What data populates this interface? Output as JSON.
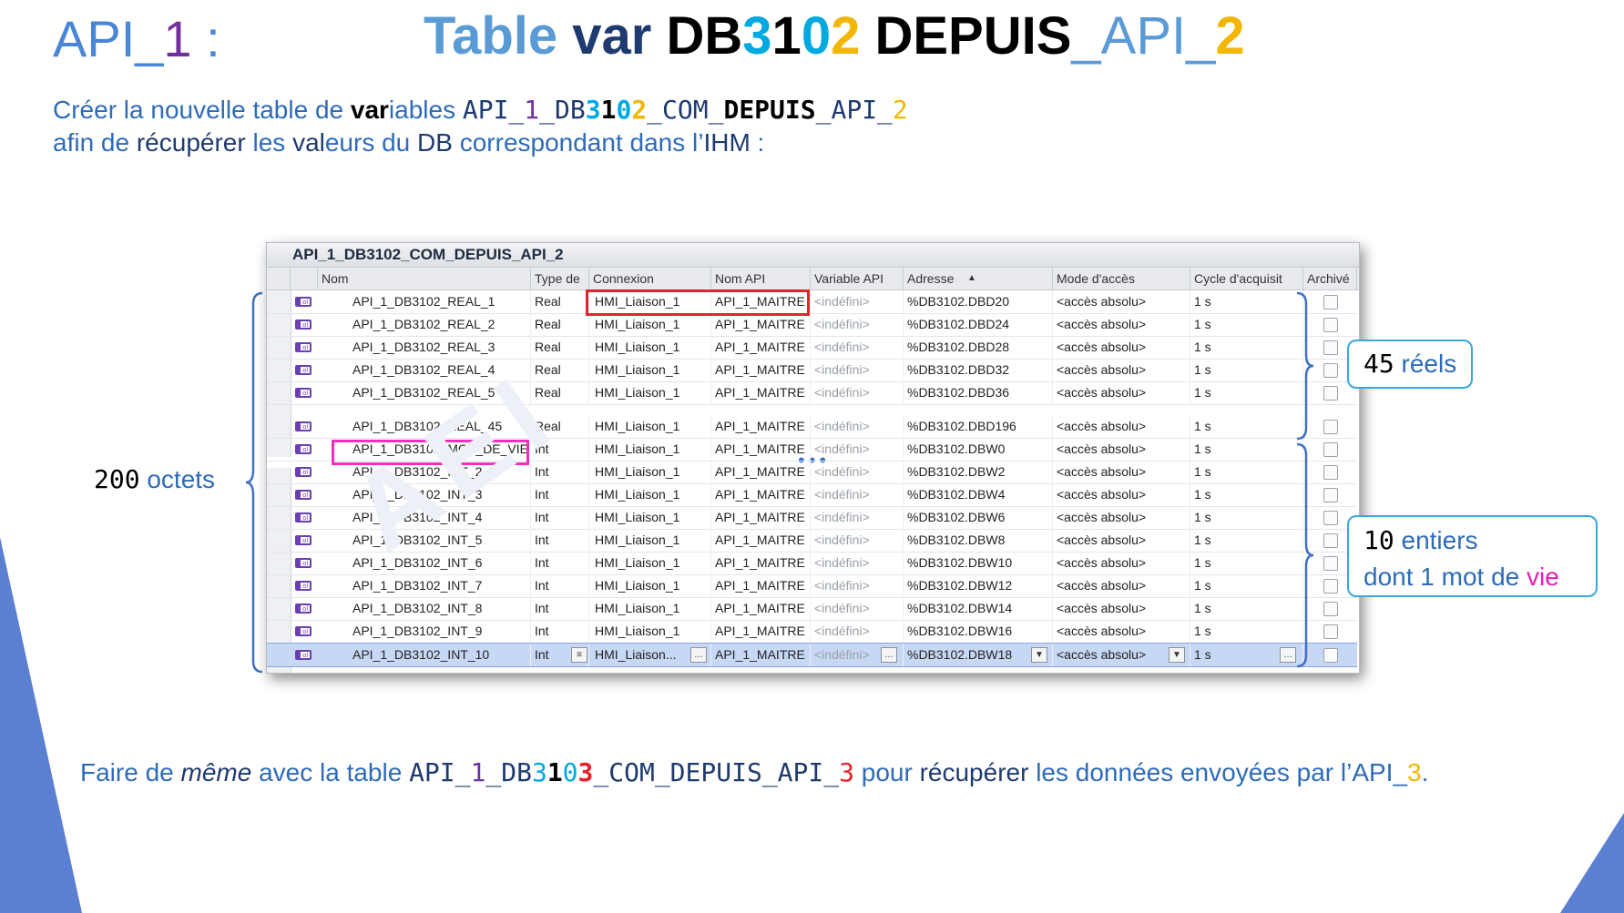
{
  "heading": {
    "left_prefix": "API_",
    "left_num": "1",
    "left_colon": " :",
    "t1": "Table ",
    "t2": "var ",
    "t3": "DB",
    "t4": "3",
    "t5": "1",
    "t6": "0",
    "t7": "2",
    "t8": " DEPUIS",
    "t9": "_API_",
    "t10": "2"
  },
  "intro": {
    "l1a": "Créer la nouvelle table de ",
    "l1b": "var",
    "l1c": "iables ",
    "l1d": "API_",
    "l1e": "1",
    "l1f": "_DB",
    "l1g": "3",
    "l1h": "1",
    "l1i": "0",
    "l1j": "2",
    "l1k": "_COM_",
    "l1l": "DEPUIS",
    "l1m": "_API_",
    "l1n": "2",
    "l2a": "afin de ",
    "l2b": "récupérer",
    "l2c": " les ",
    "l2d": "val",
    "l2e": "eurs du ",
    "l2f": "DB",
    "l2g": " correspondant dans l’",
    "l2h": "IHM",
    "l2i": " :"
  },
  "window": {
    "title": "API_1_DB3102_COM_DEPUIS_API_2",
    "columns": [
      "Nom",
      "Type de",
      "Connexion",
      "Nom API",
      "Variable API",
      "Adresse",
      "Mode d'accès",
      "Cycle d'acquisit",
      "Archivé"
    ],
    "rows": [
      [
        "API_1_DB3102_REAL_1",
        "Real",
        "HMI_Liaison_1",
        "API_1_MAITRE",
        "<indéfini>",
        "%DB3102.DBD20",
        "<accès absolu>",
        "1 s"
      ],
      [
        "API_1_DB3102_REAL_2",
        "Real",
        "HMI_Liaison_1",
        "API_1_MAITRE",
        "<indéfini>",
        "%DB3102.DBD24",
        "<accès absolu>",
        "1 s"
      ],
      [
        "API_1_DB3102_REAL_3",
        "Real",
        "HMI_Liaison_1",
        "API_1_MAITRE",
        "<indéfini>",
        "%DB3102.DBD28",
        "<accès absolu>",
        "1 s"
      ],
      [
        "API_1_DB3102_REAL_4",
        "Real",
        "HMI_Liaison_1",
        "API_1_MAITRE",
        "<indéfini>",
        "%DB3102.DBD32",
        "<accès absolu>",
        "1 s"
      ],
      [
        "API_1_DB3102_REAL_5",
        "Real",
        "HMI_Liaison_1",
        "API_1_MAITRE",
        "<indéfini>",
        "%DB3102.DBD36",
        "<accès absolu>",
        "1 s"
      ],
      [
        "API_1_DB3102_REAL_45",
        "Real",
        "HMI_Liaison_1",
        "API_1_MAITRE",
        "<indéfini>",
        "%DB3102.DBD196",
        "<accès absolu>",
        "1 s"
      ],
      [
        "API_1_DB3102_MOT_DE_VIE",
        "Int",
        "HMI_Liaison_1",
        "API_1_MAITRE",
        "<indéfini>",
        "%DB3102.DBW0",
        "<accès absolu>",
        "1 s"
      ],
      [
        "API_1_DB3102_INT_2",
        "Int",
        "HMI_Liaison_1",
        "API_1_MAITRE",
        "<indéfini>",
        "%DB3102.DBW2",
        "<accès absolu>",
        "1 s"
      ],
      [
        "API_1_DB3102_INT_3",
        "Int",
        "HMI_Liaison_1",
        "API_1_MAITRE",
        "<indéfini>",
        "%DB3102.DBW4",
        "<accès absolu>",
        "1 s"
      ],
      [
        "API_1_DB3102_INT_4",
        "Int",
        "HMI_Liaison_1",
        "API_1_MAITRE",
        "<indéfini>",
        "%DB3102.DBW6",
        "<accès absolu>",
        "1 s"
      ],
      [
        "API_1_DB3102_INT_5",
        "Int",
        "HMI_Liaison_1",
        "API_1_MAITRE",
        "<indéfini>",
        "%DB3102.DBW8",
        "<accès absolu>",
        "1 s"
      ],
      [
        "API_1_DB3102_INT_6",
        "Int",
        "HMI_Liaison_1",
        "API_1_MAITRE",
        "<indéfini>",
        "%DB3102.DBW10",
        "<accès absolu>",
        "1 s"
      ],
      [
        "API_1_DB3102_INT_7",
        "Int",
        "HMI_Liaison_1",
        "API_1_MAITRE",
        "<indéfini>",
        "%DB3102.DBW12",
        "<accès absolu>",
        "1 s"
      ],
      [
        "API_1_DB3102_INT_8",
        "Int",
        "HMI_Liaison_1",
        "API_1_MAITRE",
        "<indéfini>",
        "%DB3102.DBW14",
        "<accès absolu>",
        "1 s"
      ],
      [
        "API_1_DB3102_INT_9",
        "Int",
        "HMI_Liaison_1",
        "API_1_MAITRE",
        "<indéfini>",
        "%DB3102.DBW16",
        "<accès absolu>",
        "1 s"
      ],
      [
        "API_1_DB3102_INT_10",
        "Int",
        "HMI_Liaison...",
        "API_1_MAITRE",
        "<indéfini>",
        "%DB3102.DBW18",
        "<accès absolu>",
        "1 s"
      ]
    ]
  },
  "annotations": {
    "octets_num": "200",
    "octets_label": " octets",
    "reels_num": "45",
    "reels_label": " réels",
    "entiers_num": "10",
    "entiers_label": " entiers",
    "vie_a": "dont 1 mot de ",
    "vie_b": "vie"
  },
  "bottom": {
    "a": "Faire de ",
    "b": "même",
    "c": " avec la table ",
    "d": "API_",
    "e": "1",
    "f": "_DB",
    "g": "3",
    "h": "1",
    "i": "0",
    "j": "3",
    "k": "_COM_DEPUIS_API_",
    "l": "3",
    "m": " pour ",
    "n": "récupérer",
    "o": " les données envoyées par l’API_",
    "p": "3",
    "q": "."
  }
}
